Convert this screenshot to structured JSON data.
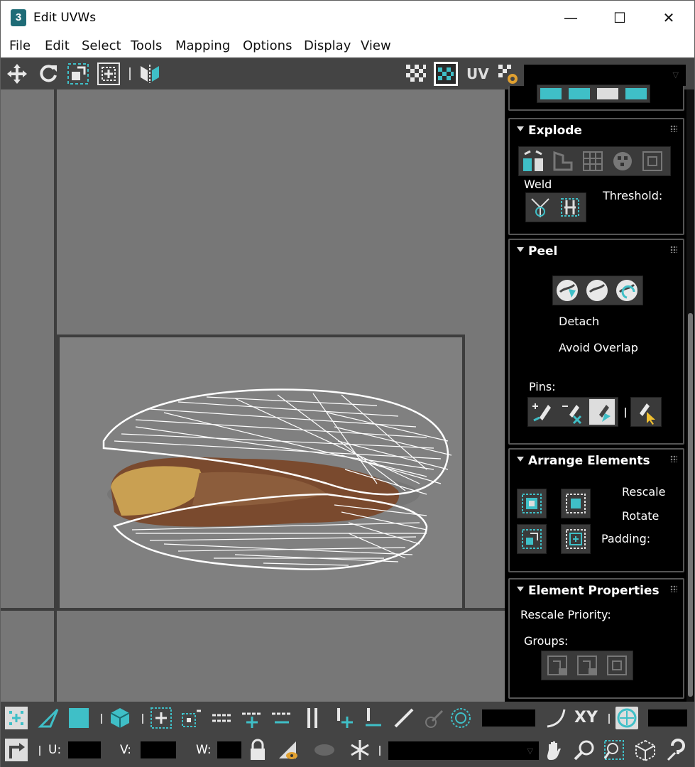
{
  "window": {
    "title": "Edit UVWs",
    "app_icon_text": "3",
    "minimize_glyph": "—",
    "maximize_glyph": "☐",
    "close_glyph": "✕"
  },
  "menu": [
    "File",
    "Edit",
    "Select",
    "Tools",
    "Mapping",
    "Options",
    "Display",
    "View"
  ],
  "toolbar": {
    "uv_label": "UV",
    "texture_dropdown_value": ""
  },
  "panel": {
    "explode": {
      "title": "Explode",
      "weld_label": "Weld",
      "threshold_label": "Threshold:"
    },
    "peel": {
      "title": "Peel",
      "detach_label": "Detach",
      "avoid_overlap_label": "Avoid Overlap",
      "pins_label": "Pins:"
    },
    "arrange": {
      "title": "Arrange Elements",
      "rescale_label": "Rescale",
      "rotate_label": "Rotate",
      "padding_label": "Padding:"
    },
    "element_props": {
      "title": "Element Properties",
      "rescale_priority_label": "Rescale Priority:",
      "groups_label": "Groups:"
    }
  },
  "status": {
    "u_label": "U:",
    "v_label": "V:",
    "w_label": "W:",
    "xy_label": "XY"
  },
  "colors": {
    "accent": "#3fbfc7",
    "panel_bg": "#000000",
    "toolbar_bg": "#444444",
    "canvas_bg": "#777777"
  },
  "icons": [
    "move-icon",
    "rotate-icon",
    "scale-icon",
    "freeform-icon",
    "mirror-icon",
    "checker-icon",
    "uv-icon",
    "settings-icon",
    "vertex-select-icon",
    "edge-select-icon",
    "face-select-icon",
    "element-select-icon",
    "lock-icon",
    "eye-icon",
    "snowflake-icon",
    "pan-hand-icon",
    "zoom-icon",
    "zoom-region-icon",
    "zoom-extents-icon",
    "help-icon"
  ]
}
